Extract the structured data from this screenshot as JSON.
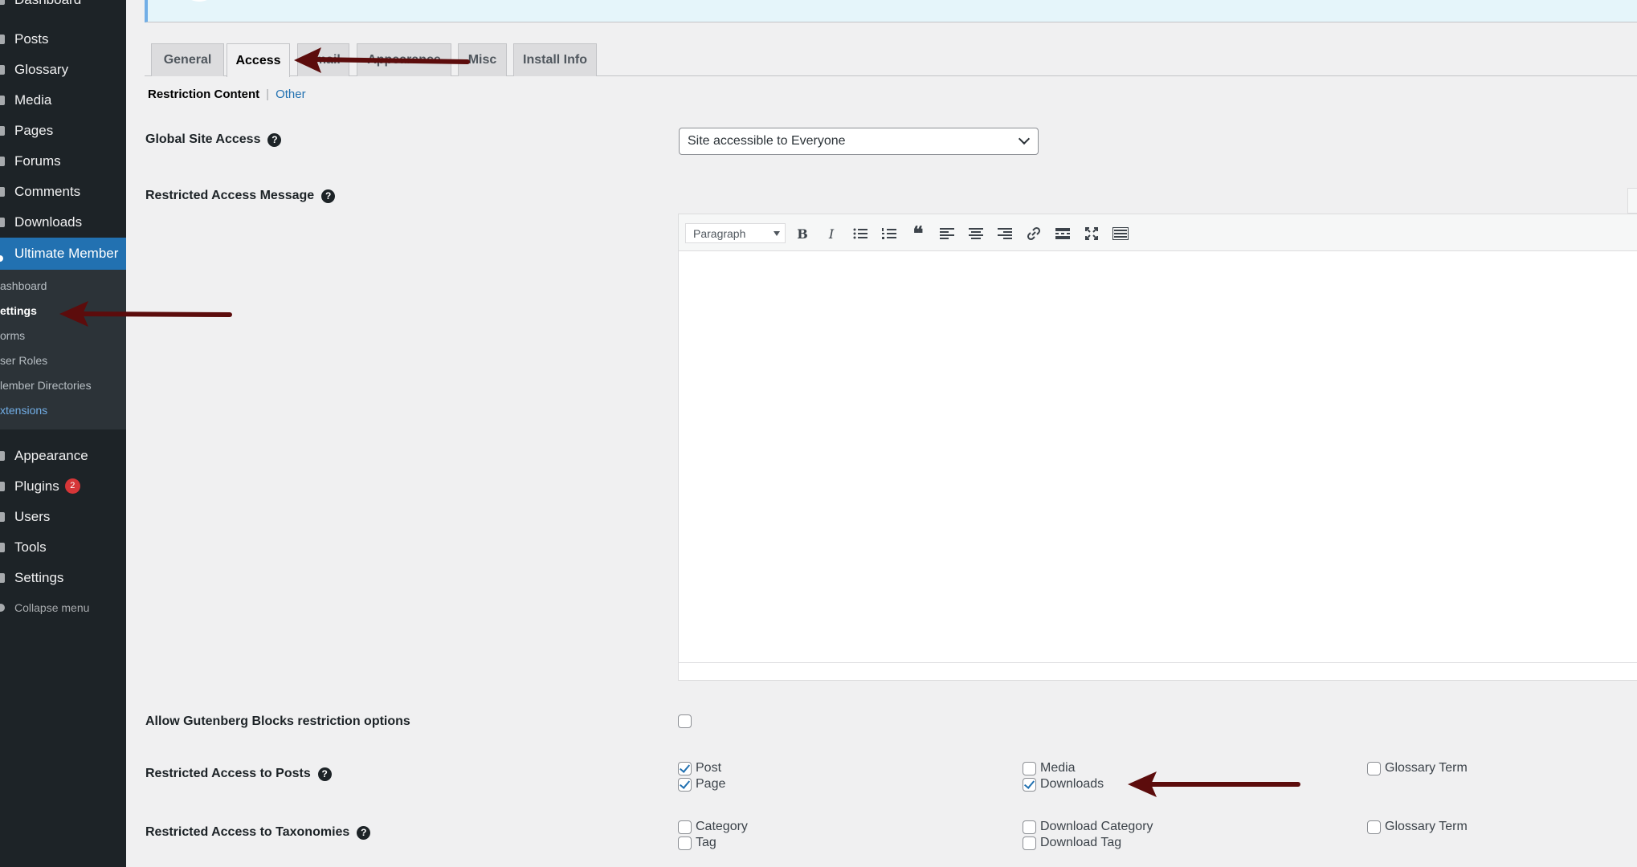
{
  "sidebar": {
    "items": [
      {
        "label": "Dashboard"
      },
      {
        "label": "Posts"
      },
      {
        "label": "Glossary"
      },
      {
        "label": "Media"
      },
      {
        "label": "Pages"
      },
      {
        "label": "Forums"
      },
      {
        "label": "Comments"
      },
      {
        "label": "Downloads"
      },
      {
        "label": "Ultimate Member"
      }
    ],
    "submenu": [
      {
        "label": "ashboard"
      },
      {
        "label": "ettings"
      },
      {
        "label": "orms"
      },
      {
        "label": "ser Roles"
      },
      {
        "label": "lember Directories"
      },
      {
        "label": "xtensions"
      }
    ],
    "bottom_items": [
      {
        "label": "Appearance"
      },
      {
        "label": "Plugins",
        "badge": "2"
      },
      {
        "label": "Users"
      },
      {
        "label": "Tools"
      },
      {
        "label": "Settings"
      }
    ],
    "collapse_label": "Collapse menu"
  },
  "tabs": [
    {
      "label": "General"
    },
    {
      "label": "Access"
    },
    {
      "label": "Email"
    },
    {
      "label": "Appearance"
    },
    {
      "label": "Misc"
    },
    {
      "label": "Install Info"
    }
  ],
  "subnav": {
    "current": "Restriction Content",
    "separator": "|",
    "other": "Other"
  },
  "fields": {
    "global_site_access": {
      "label": "Global Site Access",
      "value": "Site accessible to Everyone"
    },
    "restricted_message": {
      "label": "Restricted Access Message",
      "format": "Paragraph"
    },
    "gutenberg": {
      "label": "Allow Gutenberg Blocks restriction options",
      "checked": false
    },
    "restricted_posts": {
      "label": "Restricted Access to Posts",
      "options": [
        {
          "label": "Post",
          "checked": true
        },
        {
          "label": "Page",
          "checked": true
        },
        {
          "label": "Media",
          "checked": false
        },
        {
          "label": "Downloads",
          "checked": true
        },
        {
          "label": "Glossary Term",
          "checked": false
        }
      ]
    },
    "restricted_taxonomies": {
      "label": "Restricted Access to Taxonomies",
      "options": [
        {
          "label": "Category",
          "checked": false
        },
        {
          "label": "Tag",
          "checked": false
        },
        {
          "label": "Download Category",
          "checked": false
        },
        {
          "label": "Download Tag",
          "checked": false
        },
        {
          "label": "Glossary Term",
          "checked": false
        }
      ]
    }
  },
  "help_glyph": "?",
  "colors": {
    "admin_bg": "#1d2327",
    "submenu_bg": "#2c3338",
    "accent": "#2271b1",
    "annotation_arrow": "#5c0c0c"
  },
  "icons": [
    "bold-icon",
    "italic-icon",
    "bullet-list-icon",
    "numbered-list-icon",
    "blockquote-icon",
    "align-left-icon",
    "align-center-icon",
    "align-right-icon",
    "link-icon",
    "read-more-icon",
    "fullscreen-icon",
    "toolbar-toggle-icon"
  ]
}
